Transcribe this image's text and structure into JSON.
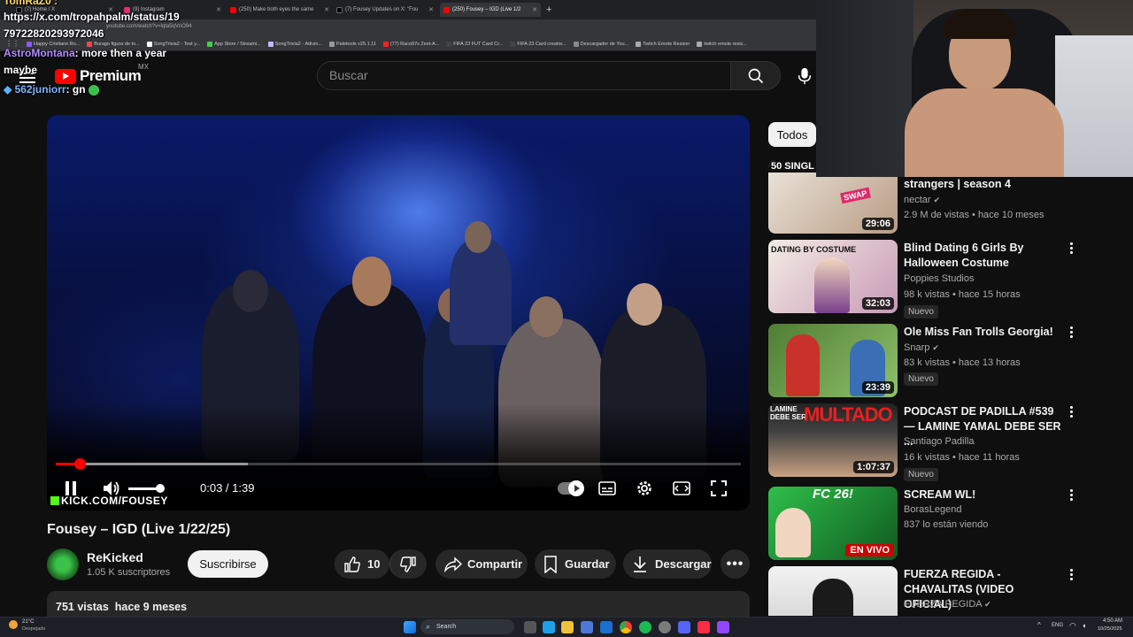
{
  "browser": {
    "tabs": [
      {
        "label": "(7) Home / X"
      },
      {
        "label": "(9) Instagram"
      },
      {
        "label": "(250) Make both eyes the same"
      },
      {
        "label": "(7) Fousey Updates on X: \"Fou"
      },
      {
        "label": "(250) Fousey – IGD (Live 1/2"
      }
    ],
    "url_partial": "youtube.com/watch?v=lqta5qVnO94",
    "bookmarks": [
      "Happy Cristiano Ro...",
      "Burago figura de to...",
      "SongTrivia2 - Test y...",
      "App Store / Streami...",
      "SongTrivia2 - Adivin...",
      "Paletools v25.1.11",
      "(77) Raco97s Zest-A...",
      "FIFA 23 FUT Card Cr...",
      "FIFA 23 Card creator...",
      "Descargador de You...",
      "Twitch Emote Resizer",
      "twitch emote resiz..."
    ]
  },
  "overlay_chat": {
    "top_user": "TomRaZ0 :",
    "line1": "https://x.com/tropahpalm/status/19",
    "line2": "7972282029397​2046",
    "user2": "AstroMontana",
    "msg2": ": more then a year",
    "line4": "maybe",
    "user3": "562juniorr",
    "msg3": ": gn"
  },
  "header": {
    "logo_text": "Premium",
    "region": "MX",
    "search_placeholder": "Buscar"
  },
  "player": {
    "time": "0:03 / 1:39",
    "progress_fraction": 0.035,
    "buffer_fraction": 0.28,
    "volume_fraction": 0.85,
    "watermark": "KICK.COM/FOUSEY"
  },
  "video": {
    "title": "Fousey – IGD (Live 1/22/25)",
    "channel": "ReKicked",
    "subscribers": "1.05 K suscriptores",
    "subscribe_label": "Suscribirse",
    "likes": "10",
    "share_label": "Compartir",
    "save_label": "Guardar",
    "download_label": "Descargar",
    "views": "751 vistas",
    "age": "hace 9 meses"
  },
  "sidebar": {
    "chip": "Todos",
    "items": [
      {
        "title": "strangers | season 4",
        "channel": "nectar",
        "meta": "2.9 M de vistas • hace 10 meses",
        "duration": "29:06",
        "badge": "",
        "thumb_text": "50 SINGL",
        "color1": "#d7c9b5",
        "color2": "#8b6a55"
      },
      {
        "title": "Blind Dating 6 Girls By Halloween Costume",
        "channel": "Poppies Studios",
        "meta": "98 k vistas • hace 15 horas",
        "duration": "32:03",
        "badge": "Nuevo",
        "thumb_text": "DATING BY COSTUME",
        "color1": "#e8dcd0",
        "color2": "#a05c8c"
      },
      {
        "title": "Ole Miss Fan Trolls Georgia!",
        "channel": "Snarp",
        "meta": "83 k vistas • hace 13 horas",
        "duration": "23:39",
        "badge": "Nuevo",
        "thumb_text": "",
        "color1": "#5a8a3c",
        "color2": "#c83a2e"
      },
      {
        "title": "PODCAST DE PADILLA #539 — LAMINE YAMAL DEBE SER ...",
        "channel": "Santiago Padilla",
        "meta": "16 k vistas • hace 11 horas",
        "duration": "1:07:37",
        "badge": "Nuevo",
        "thumb_text": "MULTADO",
        "color1": "#1a1a1a",
        "color2": "#d42020"
      },
      {
        "title": "SCREAM WL!",
        "channel": "BorasLegend",
        "meta": "837 lo están viendo",
        "duration": "",
        "badge": "",
        "live": "EN VIVO",
        "thumb_text": "FC 26!",
        "color1": "#2fbf4a",
        "color2": "#0f5a1f"
      },
      {
        "title": "FUERZA REGIDA - CHAVALITAS (VIDEO OFICIAL)",
        "channel": "FUERZA REGIDA",
        "meta": "",
        "duration": "",
        "badge": "",
        "thumb_text": "",
        "color1": "#1a1a1a",
        "color2": "#3a3a3a"
      }
    ]
  },
  "taskbar": {
    "weather_temp": "21°C",
    "weather_text": "Despejado",
    "search_label": "Search",
    "lang": "ENG",
    "time": "4:50 AM",
    "date": "10/25/2025"
  }
}
